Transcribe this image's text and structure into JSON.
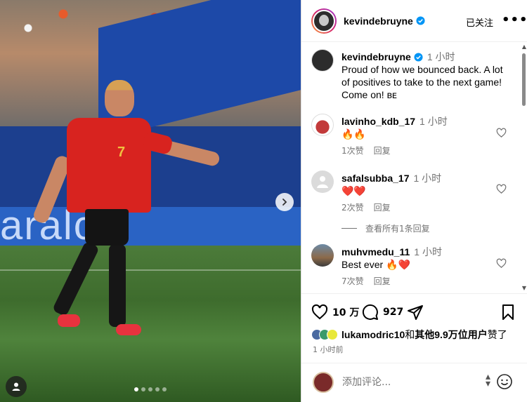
{
  "post": {
    "author": "kevindebruyne",
    "follow_status": "已关注",
    "more_label": "•••",
    "board_text": "aralco",
    "shirt_number": "7",
    "carousel": {
      "dot_count": 5,
      "active_index": 0
    }
  },
  "caption": {
    "author": "kevindebruyne",
    "time": "1 小时",
    "text": "Proud of how we bounced back. A lot of positives to take to the next game! Come on! ʙᴇ"
  },
  "comments": [
    {
      "user": "lavinho_kdb_17",
      "time": "1 小时",
      "text": "🔥🔥",
      "likes": "1次赞",
      "reply": "回复"
    },
    {
      "user": "safalsubba_17",
      "time": "1 小时",
      "text": "❤️❤️",
      "likes": "2次赞",
      "reply": "回复"
    },
    {
      "user": "muhvmedu_11",
      "time": "1 小时",
      "text": "Best ever 🔥❤️",
      "likes": "7次赞",
      "reply": "回复"
    }
  ],
  "view_replies": "查看所有1条回复",
  "actions": {
    "likes": "10 万",
    "comments": "927"
  },
  "liked_by": {
    "user": "lukamodric10",
    "middle": "和",
    "others": "其他9.9万位用户",
    "suffix": "赞了"
  },
  "posted_time": "1 小时前",
  "comment_input": {
    "placeholder": "添加评论..."
  },
  "colors": {
    "accent_blue": "#0095f6",
    "like_red": "#ed4956",
    "secondary_text": "#737373"
  }
}
